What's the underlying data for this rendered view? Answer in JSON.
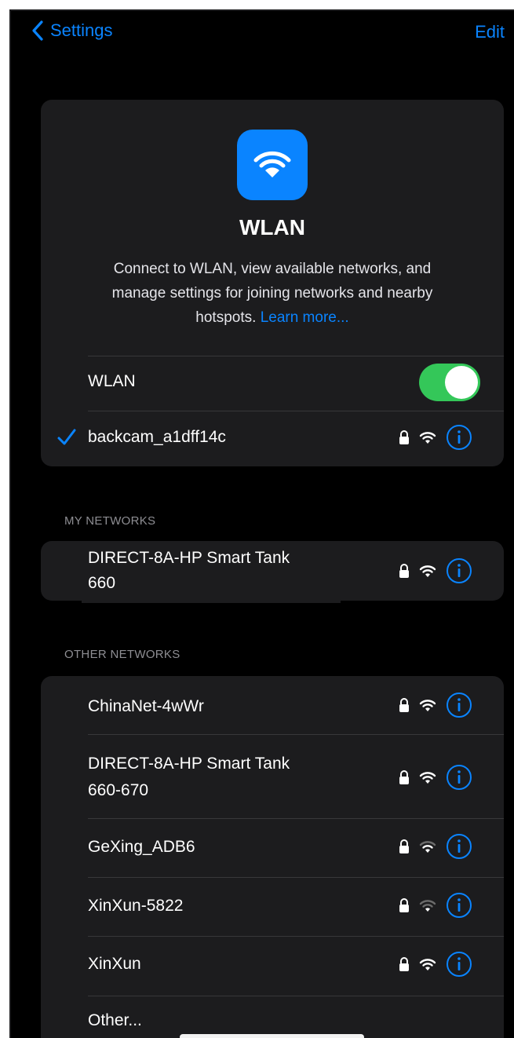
{
  "nav": {
    "back_label": "Settings",
    "edit_label": "Edit"
  },
  "header": {
    "icon": "wifi-icon",
    "title": "WLAN",
    "desc_line1": "Connect to WLAN, view available networks, and",
    "desc_line2": "manage settings for joining networks and nearby",
    "desc_line3": "hotspots.",
    "learn_more": "Learn more..."
  },
  "wlan_row": {
    "label": "WLAN",
    "toggle_on": true
  },
  "connected": {
    "name": "backcam_a1dff14c",
    "icons": [
      "checkmark-icon",
      "lock-icon",
      "wifi-icon",
      "info-icon"
    ]
  },
  "my_networks": {
    "header": "MY NETWORKS",
    "items": [
      {
        "name_line1": "DIRECT-8A-HP Smart Tank",
        "name_line2": "660"
      }
    ]
  },
  "other_networks": {
    "header": "OTHER NETWORKS",
    "items": [
      {
        "name_line1": "ChinaNet-4wWr",
        "name_line2": ""
      },
      {
        "name_line1": "DIRECT-8A-HP Smart Tank",
        "name_line2": "660-670"
      },
      {
        "name_line1": "GeXing_ADB6",
        "name_line2": ""
      },
      {
        "name_line1": "XinXun-5822",
        "name_line2": ""
      },
      {
        "name_line1": "XinXun",
        "name_line2": ""
      }
    ],
    "other_label": "Other..."
  },
  "colors": {
    "accent": "#0a84ff",
    "toggle_on": "#34c759",
    "card": "#1c1c1e",
    "background": "#000000"
  }
}
